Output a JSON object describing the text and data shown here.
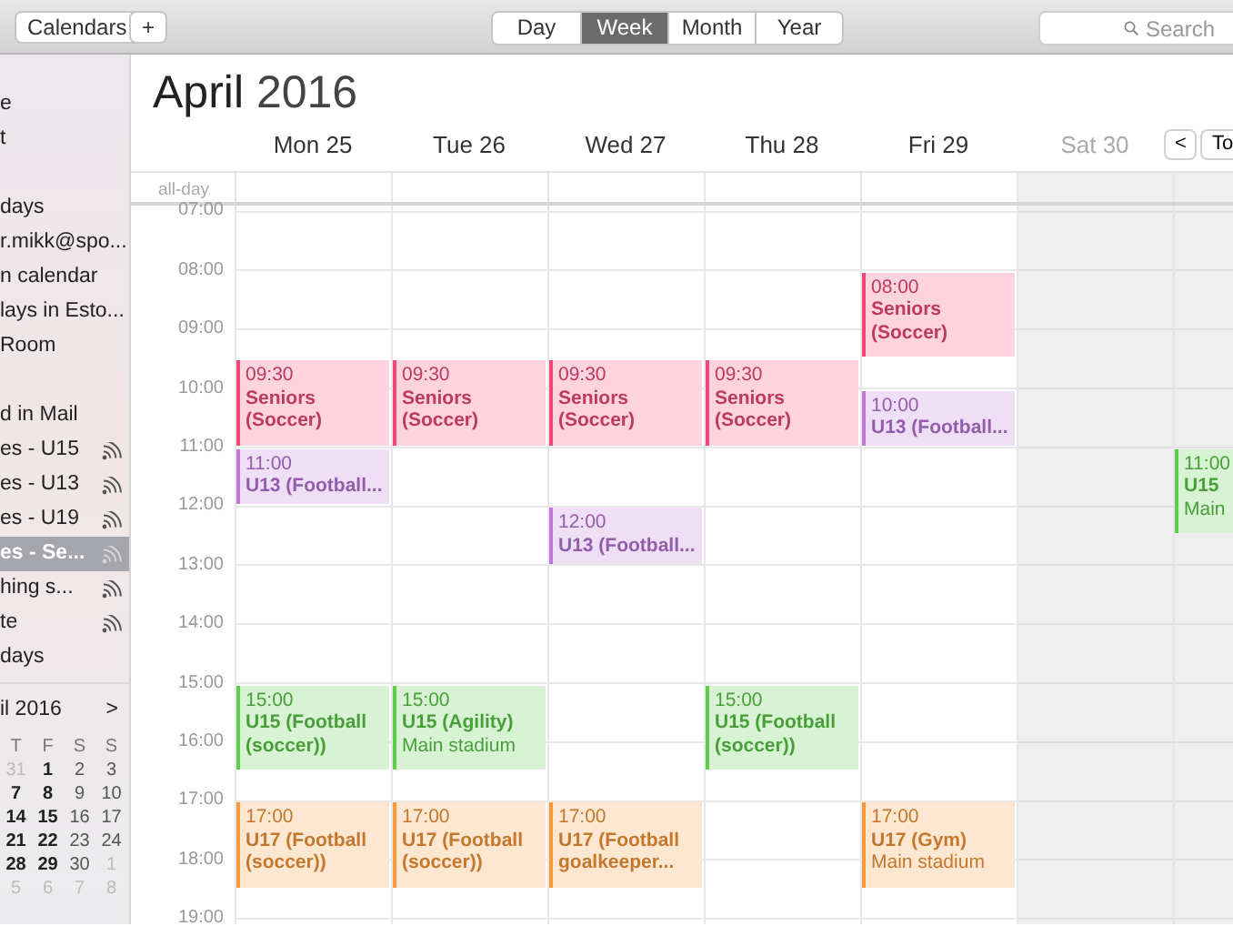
{
  "toolbar": {
    "calendars_button": "Calendars",
    "add_button": "+",
    "views": [
      {
        "label": "Day",
        "selected": false
      },
      {
        "label": "Week",
        "selected": true
      },
      {
        "label": "Month",
        "selected": false
      },
      {
        "label": "Year",
        "selected": false
      }
    ],
    "search": {
      "placeholder": "Search"
    }
  },
  "sidebar": {
    "groups": [
      {
        "items": [
          {
            "label": "e",
            "shared": false,
            "selected": false
          },
          {
            "label": "t",
            "shared": false,
            "selected": false
          }
        ]
      },
      {
        "items": [
          {
            "label": "days",
            "shared": false,
            "selected": false
          },
          {
            "label": "r.mikk@spo...",
            "shared": false,
            "selected": false
          },
          {
            "label": "n calendar",
            "shared": false,
            "selected": false
          },
          {
            "label": "lays in Esto...",
            "shared": false,
            "selected": false
          },
          {
            "label": "Room",
            "shared": false,
            "selected": false
          }
        ]
      },
      {
        "items": [
          {
            "label": "d in Mail",
            "shared": false,
            "selected": false
          },
          {
            "label": "es - U15",
            "shared": true,
            "selected": false
          },
          {
            "label": "es - U13",
            "shared": true,
            "selected": false
          },
          {
            "label": "es - U19",
            "shared": true,
            "selected": false
          },
          {
            "label": "es - Se...",
            "shared": true,
            "selected": true
          },
          {
            "label": "hing s...",
            "shared": true,
            "selected": false
          },
          {
            "label": "te",
            "shared": true,
            "selected": false
          },
          {
            "label": "days",
            "shared": false,
            "selected": false
          }
        ]
      }
    ],
    "mini_calendar": {
      "title": "il 2016",
      "next": ">",
      "weekdays": [
        "T",
        "F",
        "S",
        "S"
      ],
      "weeks": [
        [
          {
            "day": "31",
            "kind": "other"
          },
          {
            "day": "1",
            "kind": "weekday"
          },
          {
            "day": "2",
            "kind": "weekend"
          },
          {
            "day": "3",
            "kind": "weekend"
          }
        ],
        [
          {
            "day": "7",
            "kind": "weekday"
          },
          {
            "day": "8",
            "kind": "weekday"
          },
          {
            "day": "9",
            "kind": "weekend"
          },
          {
            "day": "10",
            "kind": "weekend"
          }
        ],
        [
          {
            "day": "14",
            "kind": "weekday"
          },
          {
            "day": "15",
            "kind": "weekday"
          },
          {
            "day": "16",
            "kind": "weekend"
          },
          {
            "day": "17",
            "kind": "weekend"
          }
        ],
        [
          {
            "day": "21",
            "kind": "weekday"
          },
          {
            "day": "22",
            "kind": "weekday"
          },
          {
            "day": "23",
            "kind": "weekend"
          },
          {
            "day": "24",
            "kind": "weekend"
          }
        ],
        [
          {
            "day": "28",
            "kind": "weekday"
          },
          {
            "day": "29",
            "kind": "weekday"
          },
          {
            "day": "30",
            "kind": "weekend"
          },
          {
            "day": "1",
            "kind": "other"
          }
        ],
        [
          {
            "day": "5",
            "kind": "other"
          },
          {
            "day": "6",
            "kind": "other"
          },
          {
            "day": "7",
            "kind": "other"
          },
          {
            "day": "8",
            "kind": "other"
          }
        ]
      ]
    }
  },
  "header": {
    "month": "April",
    "year": "2016",
    "prev_button": "<",
    "today_button": "To"
  },
  "all_day_label": "all-day",
  "hours": [
    "07:00",
    "08:00",
    "09:00",
    "10:00",
    "11:00",
    "12:00",
    "13:00",
    "14:00",
    "15:00",
    "16:00",
    "17:00",
    "18:00",
    "19:00"
  ],
  "days": [
    {
      "label": "Mon 25",
      "weekend": false,
      "events": [
        {
          "time": "09:30",
          "kind": "long",
          "title": "Seniors (Soccer)",
          "color": "#f2497a"
        },
        {
          "time": "11:00",
          "kind": "short",
          "title": "U13 (Football...",
          "color": "#bd79d9"
        },
        {
          "time": "15:00",
          "kind": "long",
          "title": "U15 (Football (soccer))",
          "color": "#5ccc4a"
        },
        {
          "time": "17:00",
          "kind": "long",
          "title": "U17 (Football (soccer))",
          "color": "#fb9a3a"
        }
      ]
    },
    {
      "label": "Tue 26",
      "weekend": false,
      "events": [
        {
          "time": "09:30",
          "kind": "long",
          "title": "Seniors (Soccer)",
          "color": "#f2497a"
        },
        {
          "time": "15:00",
          "kind": "long",
          "title": "U15 (Agility)",
          "location": "Main stadium",
          "color": "#5ccc4a"
        },
        {
          "time": "17:00",
          "kind": "long",
          "title": "U17 (Football (soccer))",
          "color": "#fb9a3a"
        }
      ]
    },
    {
      "label": "Wed 27",
      "weekend": false,
      "events": [
        {
          "time": "09:30",
          "kind": "long",
          "title": "Seniors (Soccer)",
          "color": "#f2497a"
        },
        {
          "time": "12:00",
          "kind": "short",
          "title": "U13 (Football...",
          "color": "#bd79d9"
        },
        {
          "time": "17:00",
          "kind": "long",
          "title": "U17 (Football goalkeeper...",
          "color": "#fb9a3a"
        }
      ]
    },
    {
      "label": "Thu 28",
      "weekend": false,
      "events": [
        {
          "time": "09:30",
          "kind": "long",
          "title": "Seniors (Soccer)",
          "color": "#f2497a"
        },
        {
          "time": "15:00",
          "kind": "long",
          "title": "U15 (Football (soccer))",
          "color": "#5ccc4a"
        }
      ]
    },
    {
      "label": "Fri 29",
      "weekend": false,
      "events": [
        {
          "time": "08:00",
          "kind": "long",
          "title": "Seniors (Soccer)",
          "color": "#f2497a"
        },
        {
          "time": "10:00",
          "kind": "short",
          "title": "U13 (Football...",
          "color": "#bd79d9"
        },
        {
          "time": "17:00",
          "kind": "long",
          "title": "U17 (Gym)",
          "location": "Main stadium",
          "color": "#fb9a3a"
        }
      ]
    },
    {
      "label": "Sat 30",
      "weekend": true
    },
    {
      "weekend": true,
      "events": [
        {
          "time": "11:00",
          "kind": "long",
          "title": "U15",
          "location": "Main",
          "color": "#5ccc4a"
        }
      ]
    }
  ]
}
